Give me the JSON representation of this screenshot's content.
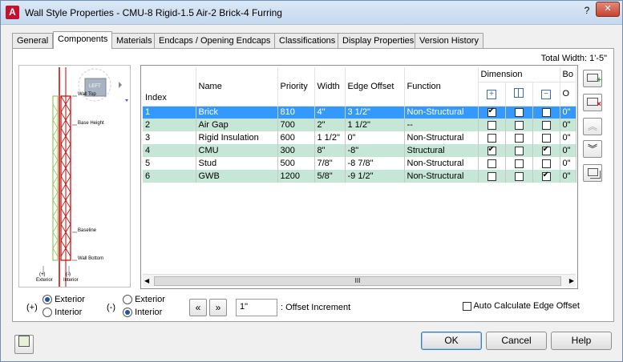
{
  "window": {
    "title": "Wall Style Properties - CMU-8 Rigid-1.5 Air-2 Brick-4 Furring",
    "help_glyph": "?",
    "close_glyph": "✕",
    "app_icon_letter": "A"
  },
  "tabs": [
    {
      "label": "General",
      "active": false
    },
    {
      "label": "Components",
      "active": true
    },
    {
      "label": "Materials",
      "active": false
    },
    {
      "label": "Endcaps / Opening Endcaps",
      "active": false
    },
    {
      "label": "Classifications",
      "active": false
    },
    {
      "label": "Display Properties",
      "active": false
    },
    {
      "label": "Version History",
      "active": false
    }
  ],
  "total_width": "Total Width: 1'-5\"",
  "preview": {
    "view_cube_label": "LEFT",
    "labels": {
      "wall_top": "Wall Top",
      "base_height": "Base Height",
      "baseline": "Baseline",
      "wall_bottom": "Wall Bottom",
      "exterior_sign": "(+)",
      "exterior": "Exterior",
      "interior_sign": "(-)",
      "interior": "Interior"
    }
  },
  "grid": {
    "headers": {
      "index": "Index",
      "name": "Name",
      "priority": "Priority",
      "width": "Width",
      "edge_offset": "Edge Offset",
      "function": "Function",
      "dimension": "Dimension",
      "bo_cut": "Bo",
      "o_cut": "O"
    },
    "rows": [
      {
        "index": "1",
        "name": "Brick",
        "priority": "810",
        "width": "4\"",
        "edge_offset": "3 1/2\"",
        "function": "Non-Structural",
        "d1": true,
        "d2": false,
        "d3": false,
        "o": "0\"",
        "selected": true
      },
      {
        "index": "2",
        "name": "Air Gap",
        "priority": "700",
        "width": "2\"",
        "edge_offset": "1 1/2\"",
        "function": "--",
        "d1": false,
        "d2": false,
        "d3": false,
        "o": "0\"",
        "selected": false
      },
      {
        "index": "3",
        "name": "Rigid Insulation",
        "priority": "600",
        "width": "1 1/2\"",
        "edge_offset": "0\"",
        "function": "Non-Structural",
        "d1": false,
        "d2": false,
        "d3": false,
        "o": "0\"",
        "selected": false
      },
      {
        "index": "4",
        "name": "CMU",
        "priority": "300",
        "width": "8\"",
        "edge_offset": "-8\"",
        "function": "Structural",
        "d1": true,
        "d2": false,
        "d3": true,
        "o": "0\"",
        "selected": false
      },
      {
        "index": "5",
        "name": "Stud",
        "priority": "500",
        "width": "7/8\"",
        "edge_offset": "-8 7/8\"",
        "function": "Non-Structural",
        "d1": false,
        "d2": false,
        "d3": false,
        "o": "0\"",
        "selected": false
      },
      {
        "index": "6",
        "name": "GWB",
        "priority": "1200",
        "width": "5/8\"",
        "edge_offset": "-9 1/2\"",
        "function": "Non-Structural",
        "d1": false,
        "d2": false,
        "d3": true,
        "o": "0\"",
        "selected": false
      }
    ],
    "scroll_thumb": "III"
  },
  "side_buttons": [
    {
      "name": "add-component-button",
      "icon": "add-row-icon"
    },
    {
      "name": "delete-component-button",
      "icon": "delete-row-icon"
    },
    {
      "name": "move-up-button",
      "icon": "double-chevron-up-icon"
    },
    {
      "name": "move-down-button",
      "icon": "double-chevron-down-icon"
    },
    {
      "name": "copy-component-button",
      "icon": "copy-row-icon"
    }
  ],
  "bottom": {
    "plus_sign": "(+)",
    "minus_sign": "(-)",
    "plus_exterior": "Exterior",
    "plus_interior": "Interior",
    "minus_exterior": "Exterior",
    "minus_interior": "Interior",
    "plus_selected": "Exterior",
    "minus_selected": "Interior",
    "offset_value": "1\"",
    "offset_label": ": Offset Increment",
    "auto_calc_label": "Auto Calculate Edge Offset",
    "auto_calc_checked": false
  },
  "buttons": {
    "ok": "OK",
    "cancel": "Cancel",
    "help": "Help"
  },
  "colors": {
    "selection": "#3399ff",
    "alt_row": "#c6e6d7",
    "wall_red": "#cc0000",
    "wall_green": "#7cc242"
  }
}
